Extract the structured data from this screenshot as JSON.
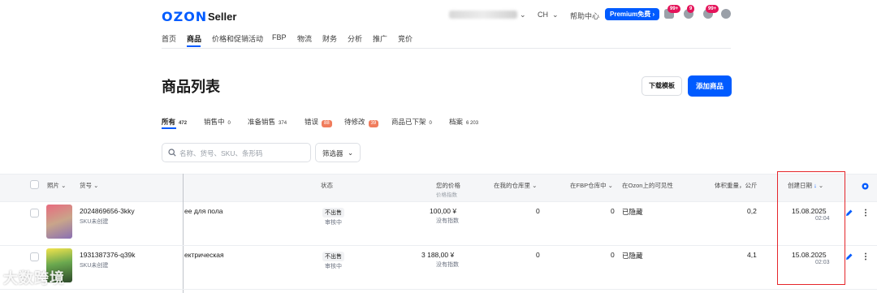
{
  "header": {
    "logo": "OZON",
    "logo_sub": "Seller",
    "region": "CH",
    "help": "帮助中心",
    "premium": "Premium免费",
    "badges": [
      "99+",
      "9",
      "99+"
    ]
  },
  "nav": {
    "items": [
      "首页",
      "商品",
      "价格和促销活动",
      "FBP",
      "物流",
      "财务",
      "分析",
      "推广",
      "竞价"
    ],
    "active": "商品"
  },
  "page": {
    "title": "商品列表",
    "download_label": "下载模板",
    "add_label": "添加商品"
  },
  "tabs": [
    {
      "label": "所有",
      "count": "472"
    },
    {
      "label": "销售中",
      "count": "0"
    },
    {
      "label": "准备销售",
      "count": "374"
    },
    {
      "label": "错误",
      "count": "88"
    },
    {
      "label": "待修改",
      "count": "39"
    },
    {
      "label": "商品已下架",
      "count": "0"
    },
    {
      "label": "档案",
      "count": "6 203"
    }
  ],
  "search": {
    "placeholder": "名称、货号、SKU、条形码"
  },
  "filter": {
    "label": "筛选器"
  },
  "table": {
    "headers": {
      "photo": "照片",
      "sku": "货号",
      "status": "状态",
      "price": "您的价格",
      "price_sub": "价格指数",
      "my_wh": "在我的仓库里",
      "fbp_wh": "在FBP仓库中",
      "visibility": "在Ozon上的可见性",
      "volume": "体积重量，公斤",
      "created": "创建日期"
    },
    "rows": [
      {
        "sku": "2024869656-3kky",
        "sku_sub": "SKU未创建",
        "name": "ee для пола",
        "status": "不出售",
        "status_sub": "审核中",
        "price": "100,00 ¥",
        "price_sub": "没有指数",
        "my_wh": "0",
        "fbp_wh": "0",
        "visibility": "已隐藏",
        "volume": "0,2",
        "date": "15.08.2025",
        "time": "02:04",
        "thumb_color": "#d94e6a"
      },
      {
        "sku": "1931387376-q39k",
        "sku_sub": "SKU未创建",
        "name": "ектрическая",
        "status": "不出售",
        "status_sub": "审核中",
        "price": "3 188,00 ¥",
        "price_sub": "没有指数",
        "my_wh": "0",
        "fbp_wh": "0",
        "visibility": "已隐藏",
        "volume": "4,1",
        "date": "15.08.2025",
        "time": "02:03",
        "thumb_color": "#6aa84f"
      }
    ]
  },
  "watermark": "大数跨境"
}
